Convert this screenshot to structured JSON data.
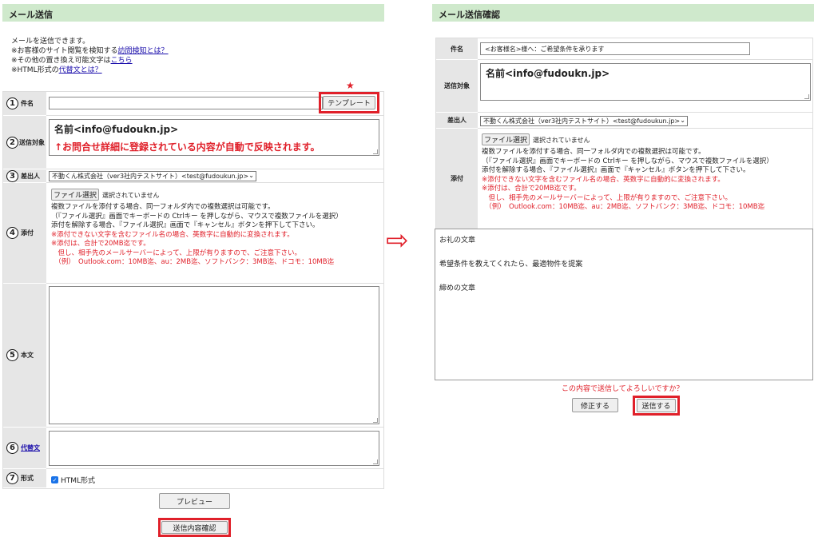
{
  "left": {
    "title": "メール送信",
    "intro": {
      "line1": "メールを送信できます。",
      "line2_prefix": "※お客様のサイト閲覧を検知する",
      "line2_link": "訪問検知とは？",
      "line3_prefix": "※その他の置き換え可能文字は",
      "line3_link": "こちら",
      "line4_prefix": "※HTML形式の",
      "line4_link": "代替文とは？"
    },
    "star": "★",
    "rows": {
      "subject": {
        "num": "1",
        "label": "件名",
        "value": ""
      },
      "recipient": {
        "num": "2",
        "label": "送信対象"
      },
      "sender": {
        "num": "3",
        "label": "差出人"
      },
      "attach": {
        "num": "4",
        "label": "添付"
      },
      "body": {
        "num": "5",
        "label": "本文"
      },
      "alt": {
        "num": "6",
        "label": "代替文"
      },
      "format": {
        "num": "7",
        "label": "形式"
      }
    },
    "template_button": "テンプレート",
    "recipient_value": "名前<info@fudoukn.jp>",
    "recipient_note": "↑お問合せ詳細に登録されている内容が自動で反映されます。",
    "sender_value": "不動くん株式会社（ver3社内テストサイト）<test@fudoukun.jp>",
    "file_button": "ファイル選択",
    "file_status": "選択されていません",
    "attach_notes": [
      "複数ファイルを添付する場合、同一フォルダ内での複数選択は可能です。",
      "（『ファイル選択』画面でキーボードの Ctrlキー を押しながら、マウスで複数ファイルを選択）",
      "添付を解除する場合、『ファイル選択』画面で『キャンセル』ボタンを押下して下さい。"
    ],
    "attach_warnings": [
      "※添付できない文字を含むファイル名の場合、英数字に自動的に変換されます。",
      "※添付は、合計で20MB迄です。",
      "　但し、相手先のメールサーバーによって、上限が有りますので、ご注意下さい。",
      "　（例）　Outlook.com：10MB迄、au：2MB迄、ソフトバンク：3MB迄、ドコモ：10MB迄"
    ],
    "format_checkbox": "HTML形式",
    "preview_button": "プレビュー",
    "confirm_button": "送信内容確認"
  },
  "right": {
    "title": "メール送信確認",
    "subject_label": "件名",
    "subject_value": "<お客様名>様へ：ご希望条件を承ります",
    "recipient_label": "送信対象",
    "recipient_value": "名前<info@fudoukn.jp>",
    "sender_label": "差出人",
    "sender_value": "不動くん株式会社（ver3社内テストサイト）<test@fudoukun.jp>",
    "attach_label": "添付",
    "body_lines": [
      "お礼の文章",
      "希望条件を教えてくれたら、最適物件を提案",
      "締めの文章"
    ],
    "confirm_question": "この内容で送信してよろしいですか？",
    "edit_button": "修正する",
    "send_button": "送信する"
  },
  "arrow": "⇨",
  "colors": {
    "header_bg": "#cfe9cc",
    "red": "#e0202a",
    "label_bg": "#e6e6e6"
  }
}
